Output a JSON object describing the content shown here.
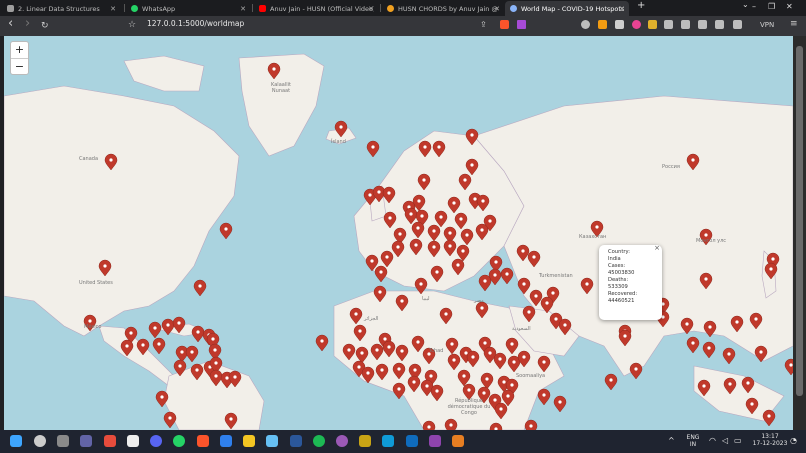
{
  "tabs": [
    {
      "title": "2. Linear Data Structures",
      "color": "#9e9e9e",
      "active": false
    },
    {
      "title": "WhatsApp",
      "color": "#25d366",
      "active": false
    },
    {
      "title": "Anuv Jain - HUSN (Official Video) - Yo",
      "color": "#ff0000",
      "active": false
    },
    {
      "title": "HUSN CHORDS by Anuv Jain @ Ultim",
      "color": "#f0a020",
      "active": false
    },
    {
      "title": "World Map - COVID-19 Hotspots",
      "color": "#8ab4f8",
      "active": true
    }
  ],
  "new_tab_label": "+",
  "window_controls": {
    "dropdown": "⌄",
    "minimize": "–",
    "restore": "❐",
    "close": "✕"
  },
  "toolbar": {
    "back": "‹",
    "forward": "›",
    "reload": "↻",
    "bookmark": "☆",
    "site_info": "◉",
    "url": "127.0.0.1:5000/worldmap",
    "vpn": "VPN",
    "share": "⇪"
  },
  "map": {
    "zoom_in": "+",
    "zoom_out": "−",
    "labels": [
      {
        "id": "nunavut",
        "text": "Kalaallit Nunaat"
      },
      {
        "id": "canada",
        "text": "Canada"
      },
      {
        "id": "iceland",
        "text": "Ísland"
      },
      {
        "id": "usa",
        "text": "United States"
      },
      {
        "id": "mexico",
        "text": "México"
      },
      {
        "id": "russia",
        "text": "Россия"
      },
      {
        "id": "kazakhstan",
        "text": "Казахстан"
      },
      {
        "id": "turkmenistan",
        "text": "Turkmenistan"
      },
      {
        "id": "mongolia",
        "text": "Монгол улс"
      },
      {
        "id": "libya",
        "text": "ليبيا"
      },
      {
        "id": "algeria",
        "text": "الجزائر"
      },
      {
        "id": "egypt",
        "text": "مصر"
      },
      {
        "id": "saudi",
        "text": "السعودية"
      },
      {
        "id": "somalia",
        "text": "Soomaaliya"
      },
      {
        "id": "chad",
        "text": "Tchad"
      },
      {
        "id": "drc",
        "text": "République démocratique du Congo"
      }
    ],
    "popup": {
      "close": "×",
      "lines": [
        "Country:",
        "India",
        "Cases:",
        "45003830",
        "Deaths:",
        "533309",
        "Recovered:",
        "44460521"
      ]
    },
    "marker_color": "#c0392b"
  },
  "taskbar": {
    "apps": [
      {
        "name": "start",
        "color": "#3ea6ff"
      },
      {
        "name": "search",
        "color": "#cccccc"
      },
      {
        "name": "settings",
        "color": "#8a8a8a"
      },
      {
        "name": "teams",
        "color": "#6264a7"
      },
      {
        "name": "app-red",
        "color": "#e74c3c"
      },
      {
        "name": "notion",
        "color": "#eeeeee"
      },
      {
        "name": "discord",
        "color": "#5865f2"
      },
      {
        "name": "whatsapp",
        "color": "#25d366"
      },
      {
        "name": "brave",
        "color": "#fb542b"
      },
      {
        "name": "vscode",
        "color": "#2f80ed"
      },
      {
        "name": "explorer",
        "color": "#f3c623"
      },
      {
        "name": "steam",
        "color": "#66c0f4"
      },
      {
        "name": "word",
        "color": "#2b579a"
      },
      {
        "name": "spotify",
        "color": "#1db954"
      },
      {
        "name": "github",
        "color": "#9b59b6"
      },
      {
        "name": "app-yellow",
        "color": "#c8a415"
      },
      {
        "name": "edge",
        "color": "#0f9bd7"
      },
      {
        "name": "outlook",
        "color": "#0f6cbd"
      },
      {
        "name": "app-purple",
        "color": "#8e44ad"
      },
      {
        "name": "app-orange",
        "color": "#e67e22"
      }
    ],
    "lang_top": "ENG",
    "lang_bottom": "IN",
    "time": "13:17",
    "date": "17-12-2023",
    "chevron": "^"
  }
}
